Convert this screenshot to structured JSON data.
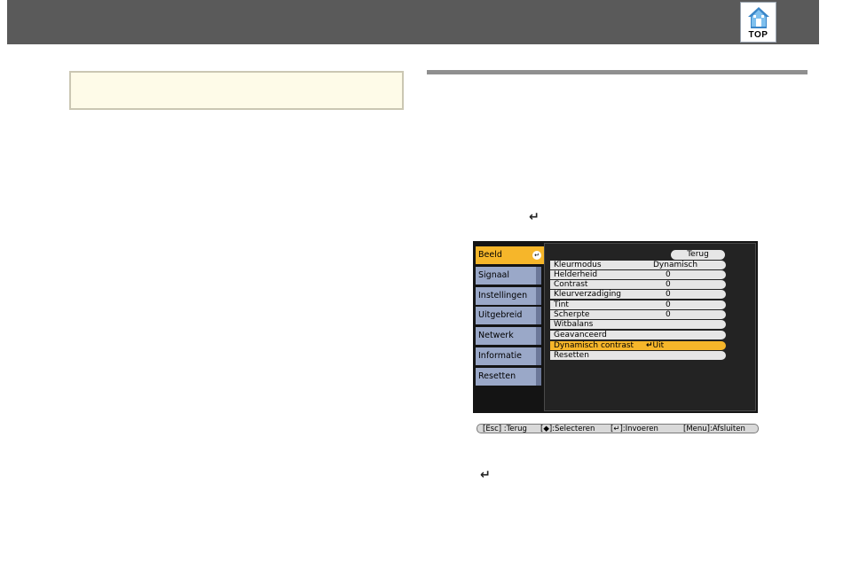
{
  "header": {
    "top_label": "TOP",
    "top_icon": "home-icon",
    "bg_color": "#5a5a5a"
  },
  "glyphs": {
    "enter_1": "↵",
    "enter_2": "↵"
  },
  "menu": {
    "sidebar": [
      {
        "label": "Beeld",
        "active": true
      },
      {
        "label": "Signaal",
        "active": false
      },
      {
        "label": "Instellingen",
        "active": false
      },
      {
        "label": "Uitgebreid",
        "active": false
      },
      {
        "label": "Netwerk",
        "active": false
      },
      {
        "label": "Informatie",
        "active": false
      },
      {
        "label": "Resetten",
        "active": false
      }
    ],
    "back_label": "Terug",
    "rows": [
      {
        "label": "Kleurmodus",
        "value": "Dynamisch"
      },
      {
        "label": "Helderheid",
        "value": "0"
      },
      {
        "label": "Contrast",
        "value": "0"
      },
      {
        "label": "Kleurverzadiging",
        "value": "0"
      },
      {
        "label": "Tint",
        "value": "0"
      },
      {
        "label": "Scherpte",
        "value": "0"
      },
      {
        "label": "Witbalans",
        "value": ""
      },
      {
        "label": "Geavanceerd",
        "value": ""
      },
      {
        "label": "Dynamisch contrast",
        "value": "Uit",
        "selected": true
      },
      {
        "label": "Resetten",
        "value": ""
      }
    ],
    "help": {
      "esc": "[Esc] :Terug",
      "select": "[◆]:Selecteren",
      "enter": "[↵]:Invoeren",
      "menu": "[Menu]:Afsluiten"
    },
    "accent_color": "#f6b62a",
    "sidebar_color": "#9aa8c8"
  }
}
